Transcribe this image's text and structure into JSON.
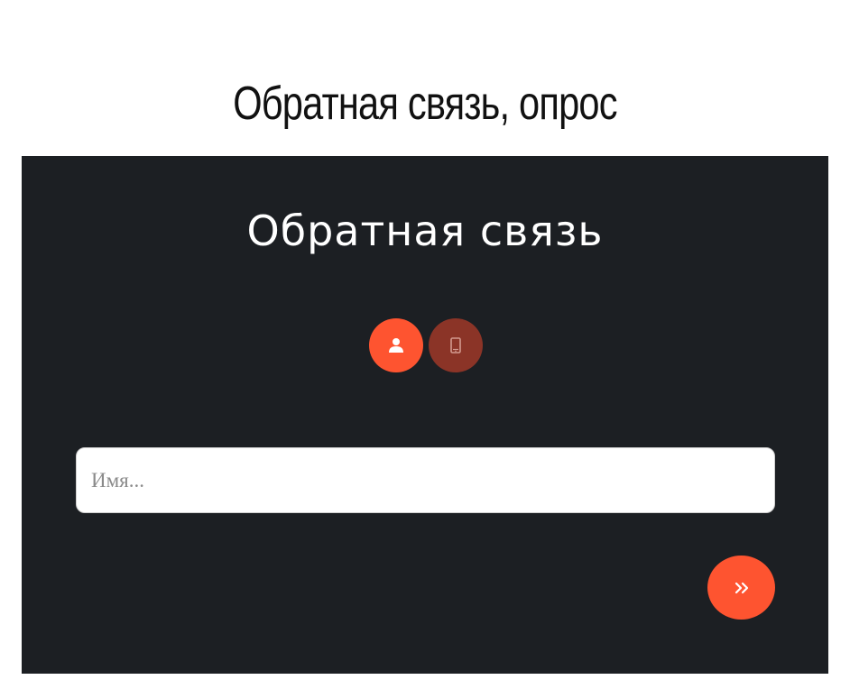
{
  "page": {
    "heading": "Обратная связь, опрос"
  },
  "form": {
    "title": "Обратная связь",
    "steps": [
      {
        "icon": "user-icon",
        "state": "active",
        "color": "#fe5430"
      },
      {
        "icon": "mobile-phone-icon",
        "state": "inactive",
        "color": "#8b3427"
      }
    ],
    "name_field": {
      "placeholder": "Имя...",
      "value": ""
    },
    "next_button": {
      "icon": "double-chevron-right-icon"
    }
  },
  "colors": {
    "panel_background": "#1c1f23",
    "accent": "#fe5430",
    "accent_dark": "#8b3427",
    "page_background": "#ffffff"
  }
}
